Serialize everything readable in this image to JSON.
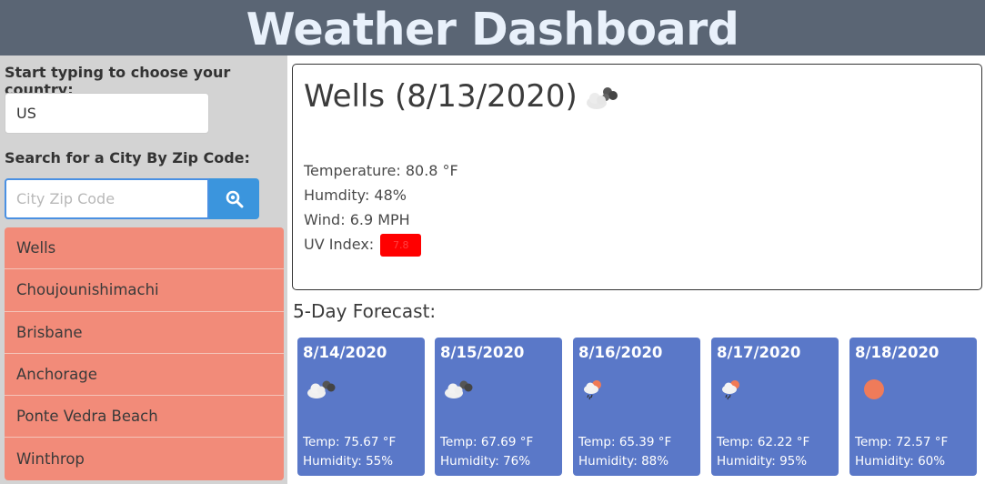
{
  "header": {
    "title": "Weather Dashboard"
  },
  "sidebar": {
    "country_label": "Start typing to choose your country:",
    "country_value": "US",
    "zip_label": "Search for a City By Zip Code:",
    "zip_placeholder": "City Zip Code",
    "search_icon": "search-icon",
    "cities": [
      "Wells",
      "Choujounishimachi",
      "Brisbane",
      "Anchorage",
      "Ponte Vedra Beach",
      "Winthrop"
    ]
  },
  "current": {
    "title": "Wells (8/13/2020)",
    "icon": "cloudy-icon",
    "temperature": "Temperature: 80.8 °F",
    "humidity": "Humdity: 48%",
    "wind": "Wind: 6.9 MPH",
    "uv_label": "UV Index:",
    "uv_value": "7.8",
    "uv_color": "#ff0000"
  },
  "forecast": {
    "title": "5-Day Forecast:",
    "days": [
      {
        "date": "8/14/2020",
        "icon": "cloudy-icon",
        "temp": "Temp: 75.67 °F",
        "humidity": "Humidity: 55%"
      },
      {
        "date": "8/15/2020",
        "icon": "cloudy-icon",
        "temp": "Temp: 67.69 °F",
        "humidity": "Humidity: 76%"
      },
      {
        "date": "8/16/2020",
        "icon": "rain-sun-icon",
        "temp": "Temp: 65.39 °F",
        "humidity": "Humidity: 88%"
      },
      {
        "date": "8/17/2020",
        "icon": "rain-sun-icon",
        "temp": "Temp: 62.22 °F",
        "humidity": "Humidity: 95%"
      },
      {
        "date": "8/18/2020",
        "icon": "sun-icon",
        "temp": "Temp: 72.57 °F",
        "humidity": "Humidity: 60%"
      }
    ]
  },
  "colors": {
    "header": "#5a6574",
    "sidebar": "#d3d3d3",
    "city_item": "#f28b79",
    "card": "#5a78c8",
    "search_button": "#3b95dd"
  }
}
